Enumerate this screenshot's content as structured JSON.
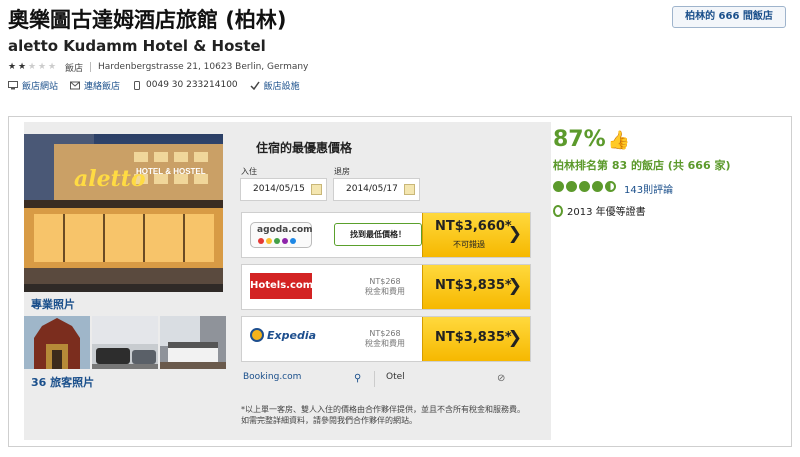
{
  "hotel": {
    "title_zh": "奧樂圖古達姆酒店旅館 (柏林)",
    "title_en": "aletto Kudamm Hotel & Hostel",
    "type_label": "飯店",
    "address": "Hardenbergstrasse 21, 10623 Berlin, Germany",
    "star_rating": 2,
    "star_max": 5,
    "city_button": "柏林的 666 間飯店"
  },
  "links": {
    "website": "飯店網站",
    "contact": "連絡飯店",
    "phone": "0049 30 233214100",
    "amenities": "飯店設施"
  },
  "photos": {
    "pro_label": "專業照片",
    "traveler_label": "36 旅客照片",
    "sign_text": "aletto",
    "sign_sub": "HOTEL & HOSTEL"
  },
  "booking": {
    "title": "住宿的最優惠價格",
    "checkin_label": "入住",
    "checkout_label": "退房",
    "checkin_value": "2014/05/15",
    "checkout_value": "2014/05/17",
    "offers": [
      {
        "provider": "agoda.com",
        "cheapest_badge": "找到最低價格！",
        "price": "NT$3,660*",
        "note": "不可錯過",
        "fee": ""
      },
      {
        "provider": "Hotels.com",
        "cheapest_badge": "",
        "price": "NT$3,835*",
        "note": "",
        "fee": "NT$268\n稅金和費用"
      },
      {
        "provider": "Expedia",
        "cheapest_badge": "",
        "price": "NT$3,835*",
        "note": "",
        "fee": "NT$268\n稅金和費用"
      }
    ],
    "other_sites": [
      "Booking.com",
      "Otel"
    ],
    "disclaimer": "*以上單一客房、雙人入住的價格由合作夥伴提供，並且不含所有稅金和服務費。 如需完整詳細資料，請參閱我們合作夥伴的網站。"
  },
  "rating": {
    "score": "87%",
    "rank_text": "柏林排名第 83 的飯店 (共 666 家)",
    "bubble_rating": 4.5,
    "reviews": "143則評論",
    "award": "2013 年優等證書"
  },
  "colors": {
    "link": "#1a4f8b",
    "green": "#5c9a2c",
    "price_yellow": "#ffd93d",
    "hotels_red": "#d32323"
  }
}
